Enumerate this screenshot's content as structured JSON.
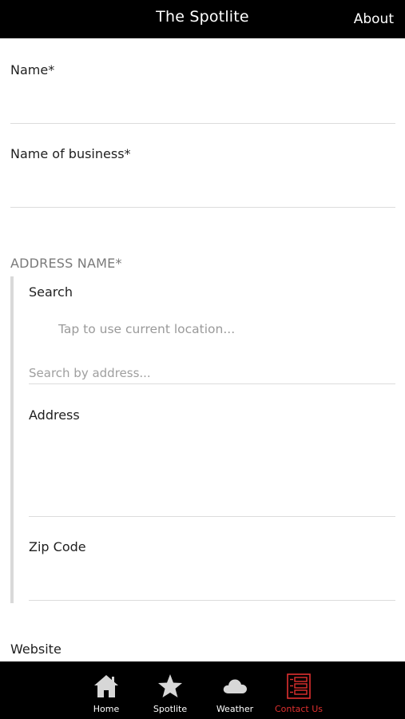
{
  "header": {
    "title": "The Spotlite",
    "about": "About"
  },
  "form": {
    "name_label": "Name*",
    "business_label": "Name of business*",
    "address_section_label": "ADDRESS NAME*",
    "address": {
      "search_label": "Search",
      "location_button": "Tap to use current location...",
      "search_placeholder": "Search by address...",
      "address_label": "Address",
      "zip_label": "Zip Code"
    },
    "website_label": "Website"
  },
  "nav": {
    "items": [
      {
        "label": "Home",
        "icon": "home-icon"
      },
      {
        "label": "Spotlite",
        "icon": "star-icon"
      },
      {
        "label": "Weather",
        "icon": "cloud-icon"
      },
      {
        "label": "Contact Us",
        "icon": "form-icon"
      }
    ],
    "active_index": 3
  },
  "colors": {
    "active": "#e0302f",
    "bar": "#000000",
    "icon_gray": "#d7d7d7"
  }
}
